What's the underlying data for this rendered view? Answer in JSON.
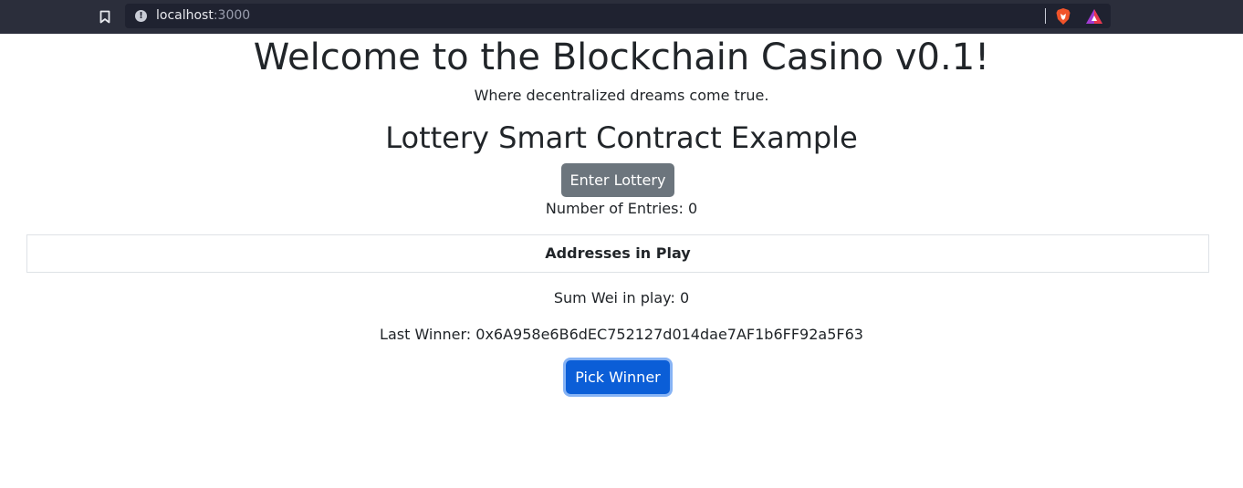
{
  "browser": {
    "url_host": "localhost",
    "url_port": ":3000",
    "icons": [
      "bookmark-icon",
      "site-info-icon",
      "brave-shields-icon",
      "brave-rewards-icon"
    ]
  },
  "page": {
    "title": "Welcome to the Blockchain Casino v0.1!",
    "tagline": "Where decentralized dreams come true.",
    "section_title": "Lottery Smart Contract Example",
    "enter_button": "Enter Lottery",
    "entries_text": "Number of Entries: 0",
    "addresses_heading": "Addresses in Play",
    "sum_wei_text": "Sum Wei in play: 0",
    "last_winner_text": "Last Winner: 0x6A958e6B6dEC752127d014dae7AF1b6FF92a5F63",
    "pick_button": "Pick Winner"
  },
  "colors": {
    "browser_bar": "#2b2e3b",
    "secondary_button": "#6c757d",
    "primary_button": "#0b5ed7"
  }
}
